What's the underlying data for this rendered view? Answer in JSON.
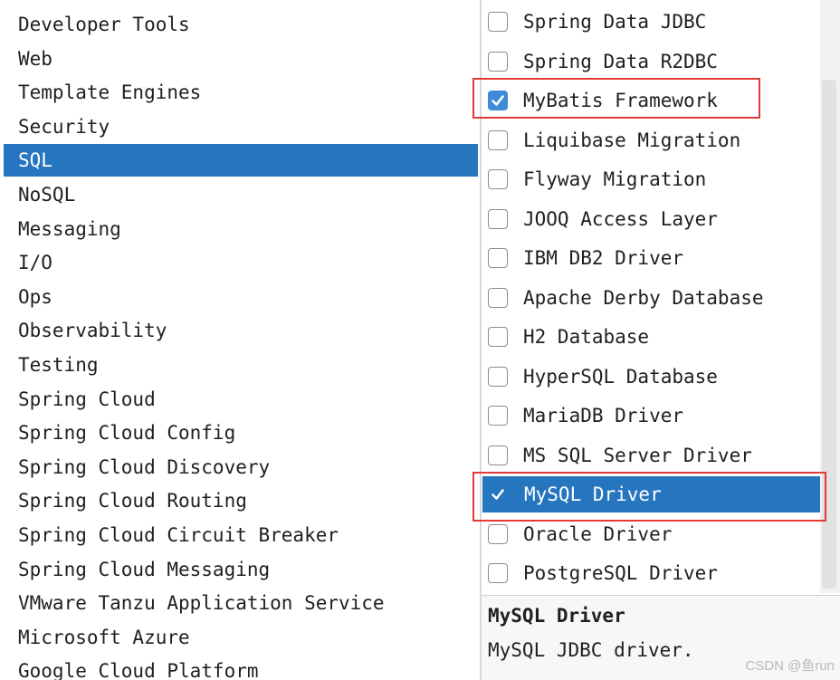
{
  "categories": {
    "selected_index": 4,
    "items": [
      {
        "label": "Developer Tools"
      },
      {
        "label": "Web"
      },
      {
        "label": "Template Engines"
      },
      {
        "label": "Security"
      },
      {
        "label": "SQL"
      },
      {
        "label": "NoSQL"
      },
      {
        "label": "Messaging"
      },
      {
        "label": "I/O"
      },
      {
        "label": "Ops"
      },
      {
        "label": "Observability"
      },
      {
        "label": "Testing"
      },
      {
        "label": "Spring Cloud"
      },
      {
        "label": "Spring Cloud Config"
      },
      {
        "label": "Spring Cloud Discovery"
      },
      {
        "label": "Spring Cloud Routing"
      },
      {
        "label": "Spring Cloud Circuit Breaker"
      },
      {
        "label": "Spring Cloud Messaging"
      },
      {
        "label": "VMware Tanzu Application Service"
      },
      {
        "label": "Microsoft Azure"
      },
      {
        "label": "Google Cloud Platform"
      }
    ]
  },
  "dependencies": {
    "items": [
      {
        "label": "Spring Data JDBC",
        "checked": false,
        "selected": false,
        "highlighted": false
      },
      {
        "label": "Spring Data R2DBC",
        "checked": false,
        "selected": false,
        "highlighted": false
      },
      {
        "label": "MyBatis Framework",
        "checked": true,
        "selected": false,
        "highlighted": true
      },
      {
        "label": "Liquibase Migration",
        "checked": false,
        "selected": false,
        "highlighted": false
      },
      {
        "label": "Flyway Migration",
        "checked": false,
        "selected": false,
        "highlighted": false
      },
      {
        "label": "JOOQ Access Layer",
        "checked": false,
        "selected": false,
        "highlighted": false
      },
      {
        "label": "IBM DB2 Driver",
        "checked": false,
        "selected": false,
        "highlighted": false
      },
      {
        "label": "Apache Derby Database",
        "checked": false,
        "selected": false,
        "highlighted": false
      },
      {
        "label": "H2 Database",
        "checked": false,
        "selected": false,
        "highlighted": false
      },
      {
        "label": "HyperSQL Database",
        "checked": false,
        "selected": false,
        "highlighted": false
      },
      {
        "label": "MariaDB Driver",
        "checked": false,
        "selected": false,
        "highlighted": false
      },
      {
        "label": "MS SQL Server Driver",
        "checked": false,
        "selected": false,
        "highlighted": false
      },
      {
        "label": "MySQL Driver",
        "checked": true,
        "selected": true,
        "highlighted": true
      },
      {
        "label": "Oracle Driver",
        "checked": false,
        "selected": false,
        "highlighted": false
      },
      {
        "label": "PostgreSQL Driver",
        "checked": false,
        "selected": false,
        "highlighted": false
      }
    ]
  },
  "description": {
    "title": "MySQL Driver",
    "text": "MySQL JDBC driver."
  },
  "watermark": "CSDN @鱼run",
  "colors": {
    "selection": "#2675bf",
    "checkbox_checked": "#3f8ad6",
    "highlight_box": "#e53935"
  },
  "icons": {
    "checkmark": "checkmark-icon"
  }
}
